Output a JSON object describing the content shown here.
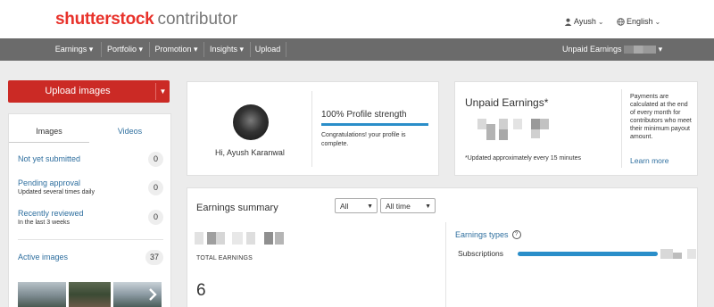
{
  "header": {
    "brand": "shutterstock",
    "product": "contributor",
    "user_name": "Ayush",
    "language": "English"
  },
  "nav": {
    "items": [
      "Earnings",
      "Portfolio",
      "Promotion",
      "Insights",
      "Upload"
    ],
    "unpaid_label": "Unpaid Earnings"
  },
  "upload": {
    "label": "Upload images"
  },
  "left_panel": {
    "tabs": [
      "Images",
      "Videos"
    ],
    "stats": [
      {
        "label": "Not yet submitted",
        "sub": "",
        "count": "0"
      },
      {
        "label": "Pending approval",
        "sub": "Updated several times daily",
        "count": "0"
      },
      {
        "label": "Recently reviewed",
        "sub": "In the last 3 weeks",
        "count": "0"
      },
      {
        "label": "Active images",
        "sub": "",
        "count": "37"
      }
    ]
  },
  "profile": {
    "greeting": "Hi, Ayush Karanwal",
    "strength_title": "100% Profile strength",
    "strength_level": 1.0,
    "congrats": "Congratulations! your profile is complete."
  },
  "unpaid": {
    "title": "Unpaid Earnings*",
    "note": "*Updated approximately every 15 minutes",
    "payments_text": "Payments are calculated at the end of every month for contributors who meet their minimum payout amount.",
    "learn_more": "Learn more"
  },
  "summary": {
    "title": "Earnings summary",
    "filter_type": "All",
    "filter_period": "All time",
    "total_label": "TOTAL EARNINGS",
    "total_value": "6",
    "types_title": "Earnings types",
    "types": [
      {
        "label": "Subscriptions",
        "share": 1.0
      }
    ]
  },
  "colors": {
    "brand_red": "#e8322b",
    "upload_red": "#cb2a25",
    "nav_bg": "#6b6b6b",
    "link_blue": "#2f6f9f",
    "bar_blue": "#2a8ec9",
    "page_bg": "#ececec"
  }
}
